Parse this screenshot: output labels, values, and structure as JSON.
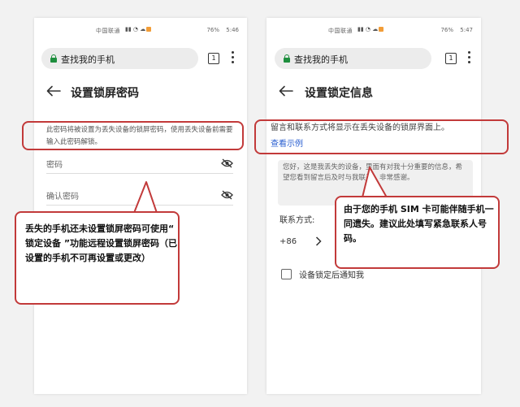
{
  "colors": {
    "accent_red": "#c23a3a",
    "link_blue": "#2a5fd1",
    "lock_green": "#1e8e3e"
  },
  "left_phone": {
    "status": {
      "carrier": "中国联通",
      "battery": "76%",
      "time": "5:46"
    },
    "url_bar": {
      "text": "查找我的手机",
      "tab_count": "1"
    },
    "title": "设置锁屏密码",
    "description": "此密码将被设置为丢失设备的锁屏密码，使用丢失设备前需要输入此密码解锁。",
    "fields": [
      {
        "label": "密码"
      },
      {
        "label": "确认密码"
      }
    ]
  },
  "right_phone": {
    "status": {
      "carrier": "中国联通",
      "battery": "76%",
      "time": "5:47"
    },
    "url_bar": {
      "text": "查找我的手机",
      "tab_count": "1"
    },
    "title": "设置锁定信息",
    "description": "留言和联系方式将显示在丢失设备的锁屏界面上。",
    "example_link": "查看示例",
    "message_placeholder": "您好，这是我丢失的设备，里面有对我十分重要的信息，希望您看到留言后及时与我联系，非常感谢。",
    "contact_label": "联系方式:",
    "country_code": "+86",
    "checkbox_label": "设备锁定后通知我"
  },
  "annotations": {
    "left_note": "丢失的手机还未设置锁屏密码可使用“ 锁定设备 ”功能远程设置锁屏密码（已设置的手机不可再设置或更改）",
    "right_note": "由于您的手机 SIM 卡可能伴随手机一同遗失。建议此处填写紧急联系人号码。"
  }
}
